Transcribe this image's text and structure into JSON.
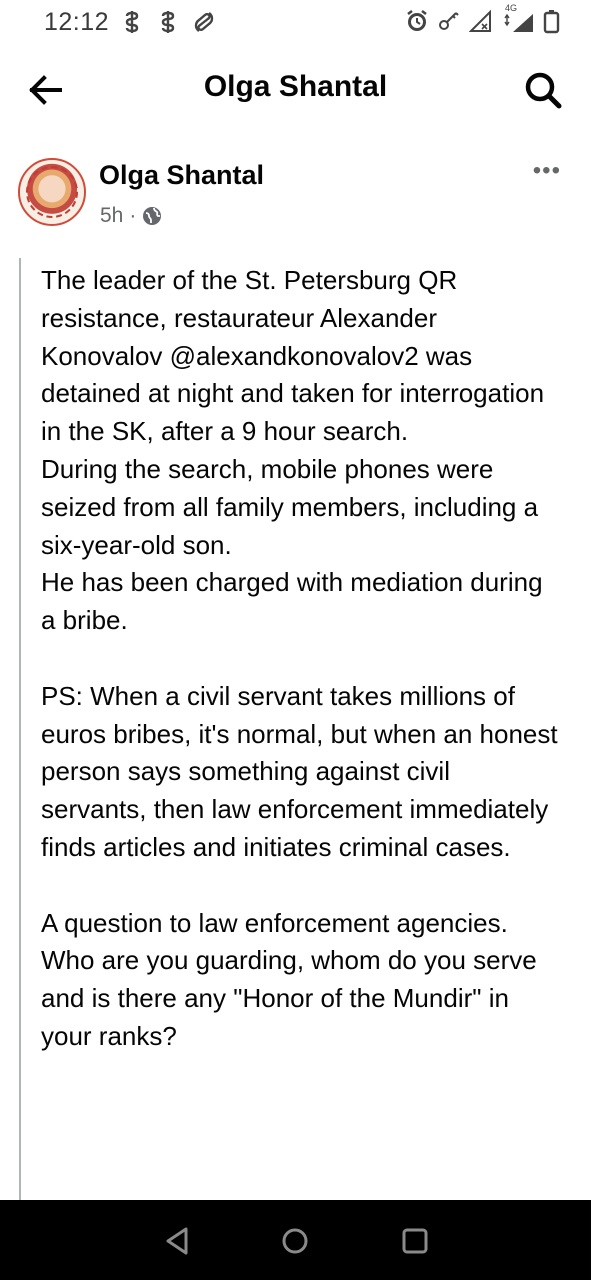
{
  "status_bar": {
    "time": "12:12",
    "network_label": "4G",
    "left_icons": [
      "money-notification-icon",
      "money-notification-icon",
      "shazam-notification-icon"
    ],
    "right_icons": [
      "alarm-icon",
      "vpn-key-icon",
      "no-signal-icon",
      "signal-icon",
      "battery-icon"
    ]
  },
  "app_bar": {
    "title": "Olga Shantal",
    "back_icon": "arrow-left-icon",
    "search_icon": "search-icon"
  },
  "post": {
    "author": "Olga Shantal",
    "time": "5h",
    "separator": "·",
    "privacy_icon": "globe-icon",
    "more_label": "•••",
    "paragraphs": {
      "p1": "The leader of the St. Petersburg QR resistance, restaurateur Alexander Konovalov @alexandkonovalov2 was detained at night and taken for interrogation in the SK, after a 9 hour search.",
      "p2": "During the search, mobile phones were seized from all family members, including a six-year-old son.",
      "p3": "He has been charged with mediation during a bribe.",
      "p4": "PS: When a civil servant takes millions of euros bribes, it's normal, but when an honest person says something against civil servants, then law enforcement immediately finds articles and initiates criminal cases.",
      "p5": "A question to law enforcement agencies.",
      "p6": "Who are you guarding, whom do you serve and is there any \"Honor of the Mundir\" in your ranks?"
    }
  },
  "nav_bar": {
    "icons": [
      "back-triangle-icon",
      "home-circle-icon",
      "recents-square-icon"
    ]
  },
  "colors": {
    "text_primary": "#050505",
    "text_secondary": "#65676b",
    "quote_border": "#b0b3b8",
    "nav_bg": "#000000"
  }
}
